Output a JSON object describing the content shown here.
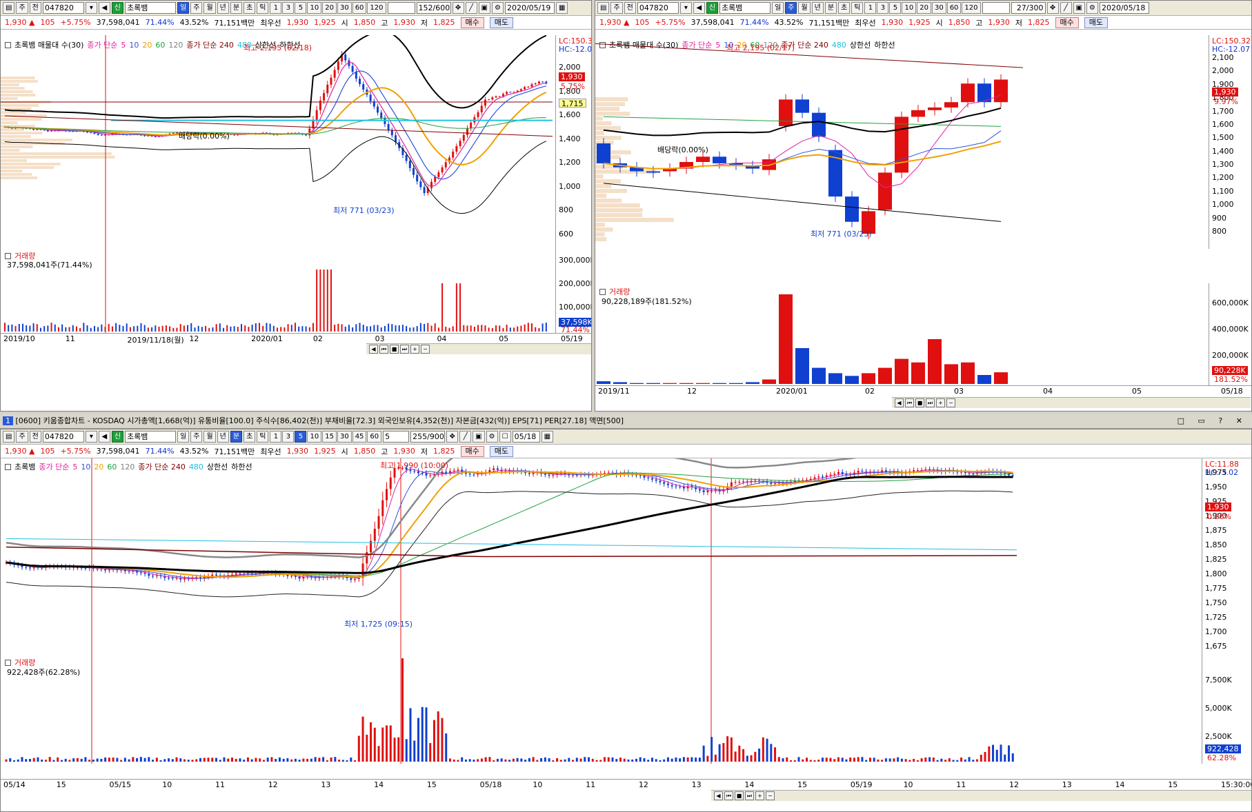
{
  "common": {
    "code": "047820",
    "name": "초록뱀",
    "tag_sin": "신",
    "btn_ju": "주",
    "btn_jeon": "전",
    "price": "1,930 ▲",
    "change": "105",
    "change_pct": "+5.75%",
    "volume": "37,598,041",
    "vol_pct": "71.44%",
    "vol_pct2": "43.52%",
    "amount": "71,151백만",
    "best_label": "최우선",
    "ask": "1,930",
    "bid": "1,925",
    "open_label": "시",
    "open": "1,850",
    "high_label": "고",
    "high": "1,930",
    "low_label": "저",
    "low": "1,825",
    "buy": "매수",
    "sell": "매도"
  },
  "panel1": {
    "period_tabs": [
      "일",
      "주",
      "월",
      "년",
      "분",
      "초",
      "틱"
    ],
    "active_tab": "일",
    "numbers": [
      "1",
      "3",
      "5",
      "10",
      "20",
      "30",
      "60",
      "120"
    ],
    "count": "152/600",
    "date": "2020/05/19",
    "legend_name": "초록뱀 매물대 수(30)",
    "legend_ma": "종가 단순",
    "ma1": "5",
    "ma2": "10",
    "ma3": "20",
    "ma4": "60",
    "ma5": "120",
    "legend_ma2": "종가 단순 240",
    "ma6": "480",
    "upper": "상한선",
    "lower": "하한선",
    "lc": "LC:150.32",
    "hc": "HC:-12.07",
    "yticks": [
      "2,000",
      "1,800",
      "1,600",
      "1,400",
      "1,200",
      "1,000",
      "800",
      "600"
    ],
    "price_tag": "1,930",
    "pct_tag": "5.75%",
    "ma_tag": "1,715",
    "high_note": "최고 2,195 (02/18)",
    "low_note": "최저 771 (03/23)",
    "dividend_note": "배당락(0.00%)",
    "vol_title": "거래량",
    "vol_value": "37,598,041주(71.44%)",
    "vol_yticks": [
      "300,000K",
      "200,000K",
      "100,000K"
    ],
    "vol_tag": "37,598K",
    "vol_tag2": "71.44%",
    "xlabels": [
      "2019/10",
      "11",
      "2019/11/18(월)",
      "12",
      "2020/01",
      "02",
      "03",
      "04",
      "05",
      "05/19"
    ]
  },
  "panel2": {
    "period_tabs": [
      "일",
      "주",
      "월",
      "년",
      "분",
      "초",
      "틱"
    ],
    "active_tab": "주",
    "numbers": [
      "1",
      "3",
      "5",
      "10",
      "20",
      "30",
      "60",
      "120"
    ],
    "count": "27/300",
    "date": "2020/05/18",
    "legend_name": "초록뱀 매물대 수(30)",
    "legend_ma": "종가 단순",
    "ma1": "5",
    "ma2": "10",
    "ma3": "20",
    "ma4": "60",
    "ma5": "120",
    "legend_ma2": "종가 단순 240",
    "ma6": "480",
    "upper": "상한선",
    "lower": "하한선",
    "lc": "LC:150.32",
    "hc": "HC:-12.07",
    "yticks": [
      "2,100",
      "2,000",
      "1,900",
      "1,800",
      "1,700",
      "1,600",
      "1,500",
      "1,400",
      "1,300",
      "1,200",
      "1,100",
      "1,000",
      "900",
      "800"
    ],
    "price_tag": "1,930",
    "pct_tag": "9.97%",
    "high_note": "최고 2,195 (02/17)",
    "low_note": "최저 771 (03/23)",
    "dividend_note": "배당락(0.00%)",
    "vol_title": "거래량",
    "vol_value": "90,228,189주(181.52%)",
    "vol_yticks": [
      "600,000K",
      "400,000K",
      "200,000K"
    ],
    "vol_tag": "90,228K",
    "vol_tag2": "181.52%",
    "xlabels": [
      "2019/11",
      "12",
      "2020/01",
      "02",
      "03",
      "04",
      "05",
      "05/18"
    ]
  },
  "titlebar": {
    "text": "[0600] 키움종합차트 - KOSDAQ 시가총액[1,668(억)] 유통비율[100.0] 주식수[86,402(천)] 부채비율[72.3] 외국인보유[4,352(천)] 자본금[432(억)] EPS[71] PER[27.18] 액면[500]",
    "badge": "1"
  },
  "panel3": {
    "period_tabs": [
      "일",
      "주",
      "월",
      "년",
      "분",
      "초",
      "틱"
    ],
    "active_tab": "분",
    "numbers": [
      "1",
      "3",
      "5",
      "10",
      "15",
      "30",
      "45",
      "60"
    ],
    "active_num": "5",
    "interval": "5",
    "count": "255/900",
    "date": "05/18",
    "legend_name": "초록뱀",
    "legend_ma": "종가 단순",
    "ma1": "5",
    "ma2": "10",
    "ma3": "20",
    "ma4": "60",
    "ma5": "120",
    "legend_ma2": "종가 단순 240",
    "ma6": "480",
    "upper": "상한선",
    "lower": "하한선",
    "lc": "LC:11.88",
    "hc": "HC:-3.02",
    "yticks": [
      "1,975",
      "1,950",
      "1,925",
      "1,900",
      "1,875",
      "1,850",
      "1,825",
      "1,800",
      "1,775",
      "1,750",
      "1,725",
      "1,700",
      "1,675"
    ],
    "price_tag": "1,930",
    "pct_tag": "0.26%",
    "high_note": "최고 1,990 (10:00)",
    "low_note": "최저 1,725 (09:15)",
    "vol_title": "거래량",
    "vol_value": "922,428주(62.28%)",
    "vol_yticks": [
      "7,500K",
      "5,000K",
      "2,500K"
    ],
    "vol_tag": "922,428",
    "vol_tag2": "62.28%",
    "xlabels": [
      "05/14",
      "15",
      "05/15",
      "10",
      "11",
      "12",
      "13",
      "14",
      "15",
      "05/18",
      "10",
      "11",
      "12",
      "13",
      "14",
      "15",
      "05/19",
      "10",
      "11",
      "12",
      "13",
      "14",
      "15",
      "15:30:00"
    ]
  },
  "colors": {
    "up": "#e01010",
    "down": "#1040d0",
    "ma5": "#e020a0",
    "ma10": "#3050e0",
    "ma20": "#f0a000",
    "ma60": "#20a040",
    "ma120": "#808080",
    "ma240": "#800000",
    "ma480": "#20c0e0",
    "band": "#000000"
  }
}
